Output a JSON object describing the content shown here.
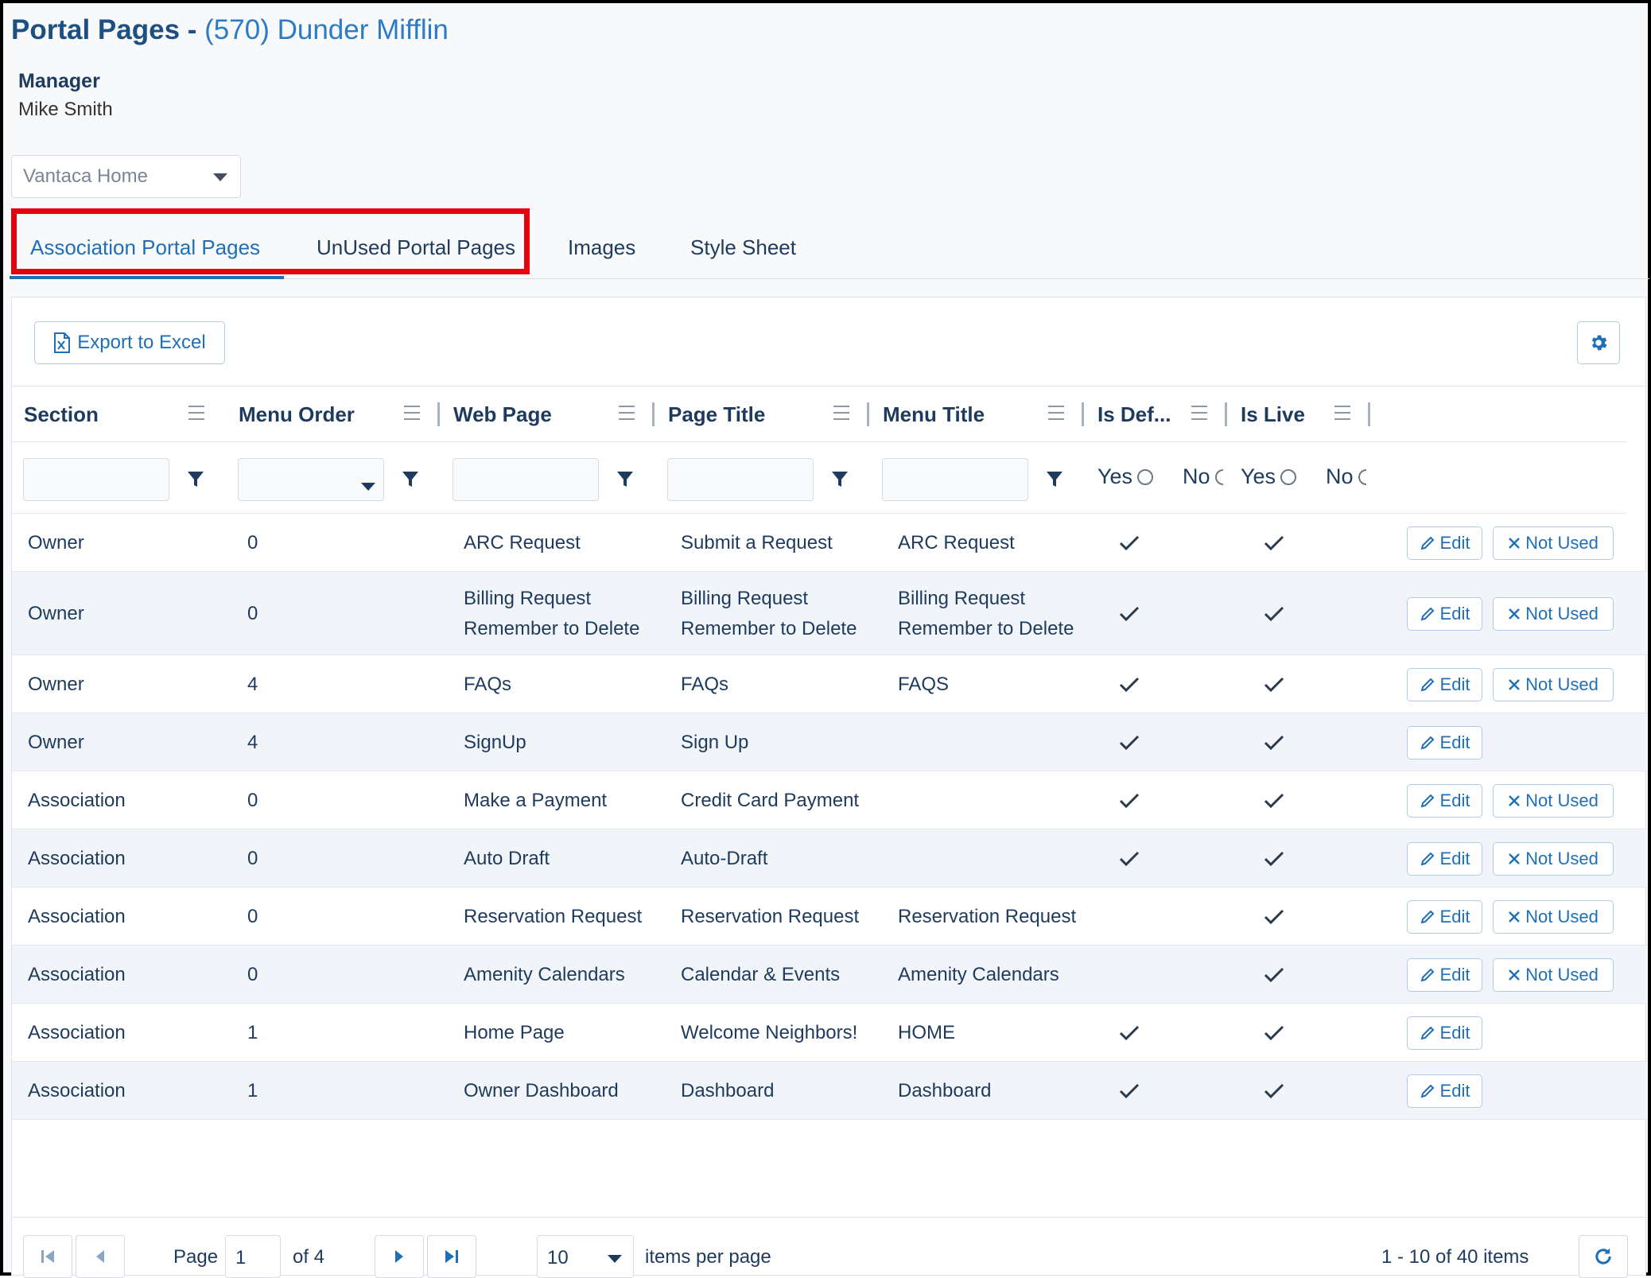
{
  "header": {
    "title": "Portal Pages -",
    "org": "(570) Dunder Mifflin",
    "manager_label": "Manager",
    "manager_name": "Mike Smith",
    "site_select_value": "Vantaca Home"
  },
  "tabs": [
    {
      "label": "Association Portal Pages",
      "active": true
    },
    {
      "label": "UnUsed Portal Pages",
      "active": false
    },
    {
      "label": "Images",
      "active": false
    },
    {
      "label": "Style Sheet",
      "active": false
    }
  ],
  "toolbar": {
    "export_label": "Export to Excel",
    "settings_icon": "gear-icon"
  },
  "columns": [
    "Section",
    "Menu Order",
    "Web Page",
    "Page Title",
    "Menu Title",
    "Is Def...",
    "Is Live"
  ],
  "filters": {
    "is_default_yes": "Yes",
    "is_default_no": "No",
    "is_live_yes": "Yes",
    "is_live_no": "No"
  },
  "rows": [
    {
      "section": "Owner",
      "menu_order": "0",
      "web_page": "ARC Request",
      "page_title": "Submit a Request",
      "menu_title": "ARC Request",
      "is_default": true,
      "is_live": true,
      "not_used": true
    },
    {
      "section": "Owner",
      "menu_order": "0",
      "web_page": "Billing Request Remember to Delete",
      "page_title": "Billing Request Remember to Delete",
      "menu_title": "Billing Request Remember to Delete",
      "is_default": true,
      "is_live": true,
      "not_used": true
    },
    {
      "section": "Owner",
      "menu_order": "4",
      "web_page": "FAQs",
      "page_title": "FAQs",
      "menu_title": "FAQS",
      "is_default": true,
      "is_live": true,
      "not_used": true
    },
    {
      "section": "Owner",
      "menu_order": "4",
      "web_page": "SignUp",
      "page_title": "Sign Up",
      "menu_title": "",
      "is_default": true,
      "is_live": true,
      "not_used": false
    },
    {
      "section": "Association",
      "menu_order": "0",
      "web_page": "Make a Payment",
      "page_title": "Credit Card Payment",
      "menu_title": "",
      "is_default": true,
      "is_live": true,
      "not_used": true
    },
    {
      "section": "Association",
      "menu_order": "0",
      "web_page": "Auto Draft",
      "page_title": "Auto-Draft",
      "menu_title": "",
      "is_default": true,
      "is_live": true,
      "not_used": true
    },
    {
      "section": "Association",
      "menu_order": "0",
      "web_page": "Reservation Request",
      "page_title": "Reservation Request",
      "menu_title": "Reservation Request",
      "is_default": false,
      "is_live": true,
      "not_used": true
    },
    {
      "section": "Association",
      "menu_order": "0",
      "web_page": "Amenity Calendars",
      "page_title": "Calendar & Events",
      "menu_title": "Amenity Calendars",
      "is_default": false,
      "is_live": true,
      "not_used": true
    },
    {
      "section": "Association",
      "menu_order": "1",
      "web_page": "Home Page",
      "page_title": "Welcome Neighbors!",
      "menu_title": "HOME",
      "is_default": true,
      "is_live": true,
      "not_used": false
    },
    {
      "section": "Association",
      "menu_order": "1",
      "web_page": "Owner Dashboard",
      "page_title": "Dashboard",
      "menu_title": "Dashboard",
      "is_default": true,
      "is_live": true,
      "not_used": false
    }
  ],
  "row_actions": {
    "edit_label": "Edit",
    "not_used_label": "Not Used"
  },
  "pager": {
    "page_label": "Page",
    "page_value": "1",
    "of_label": "of 4",
    "page_size": "10",
    "items_per_page_label": "items per page",
    "summary": "1 - 10 of 40 items"
  },
  "colors": {
    "accent": "#1f6fb8",
    "highlight": "#e3000f",
    "text": "#1e3a5c"
  }
}
